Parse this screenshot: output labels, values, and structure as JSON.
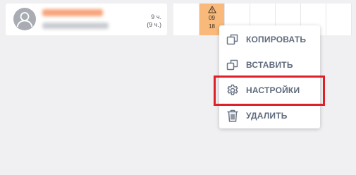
{
  "employee": {
    "hours": "9 ч.",
    "hours_paren": "(9 ч.)"
  },
  "shift": {
    "start": "09",
    "end": "18",
    "color": "#f8b97b"
  },
  "context_menu": {
    "items": [
      {
        "label": "КОПИРОВАТЬ",
        "icon": "copy-icon"
      },
      {
        "label": "ВСТАВИТЬ",
        "icon": "paste-icon"
      },
      {
        "label": "НАСТРОЙКИ",
        "icon": "gear-icon"
      },
      {
        "label": "УДАЛИТЬ",
        "icon": "trash-icon"
      }
    ],
    "highlight_color": "#e11f28"
  }
}
